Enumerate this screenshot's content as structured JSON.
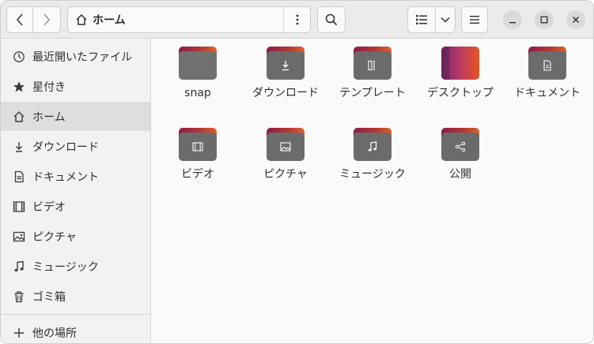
{
  "header": {
    "path_label": "ホーム"
  },
  "sidebar": {
    "items": [
      {
        "label": "最近開いたファイル",
        "icon": "recent-icon"
      },
      {
        "label": "星付き",
        "icon": "star-icon"
      },
      {
        "label": "ホーム",
        "icon": "home-icon",
        "active": true
      },
      {
        "label": "ダウンロード",
        "icon": "download-icon"
      },
      {
        "label": "ドキュメント",
        "icon": "document-icon"
      },
      {
        "label": "ビデオ",
        "icon": "video-icon"
      },
      {
        "label": "ピクチャ",
        "icon": "picture-icon"
      },
      {
        "label": "ミュージック",
        "icon": "music-icon"
      },
      {
        "label": "ゴミ箱",
        "icon": "trash-icon"
      }
    ],
    "other_places": "他の場所"
  },
  "files": [
    {
      "label": "snap",
      "icon": "folder-icon"
    },
    {
      "label": "ダウンロード",
      "icon": "download-folder-icon"
    },
    {
      "label": "テンプレート",
      "icon": "templates-folder-icon"
    },
    {
      "label": "デスクトップ",
      "icon": "desktop-folder-icon"
    },
    {
      "label": "ドキュメント",
      "icon": "documents-folder-icon"
    },
    {
      "label": "ビデオ",
      "icon": "videos-folder-icon"
    },
    {
      "label": "ピクチャ",
      "icon": "pictures-folder-icon"
    },
    {
      "label": "ミュージック",
      "icon": "music-folder-icon"
    },
    {
      "label": "公開",
      "icon": "public-folder-icon"
    }
  ],
  "colors": {
    "accent_dark": "#8c1d45",
    "accent_orange": "#e95420",
    "folder_body": "#6b6b6b"
  }
}
